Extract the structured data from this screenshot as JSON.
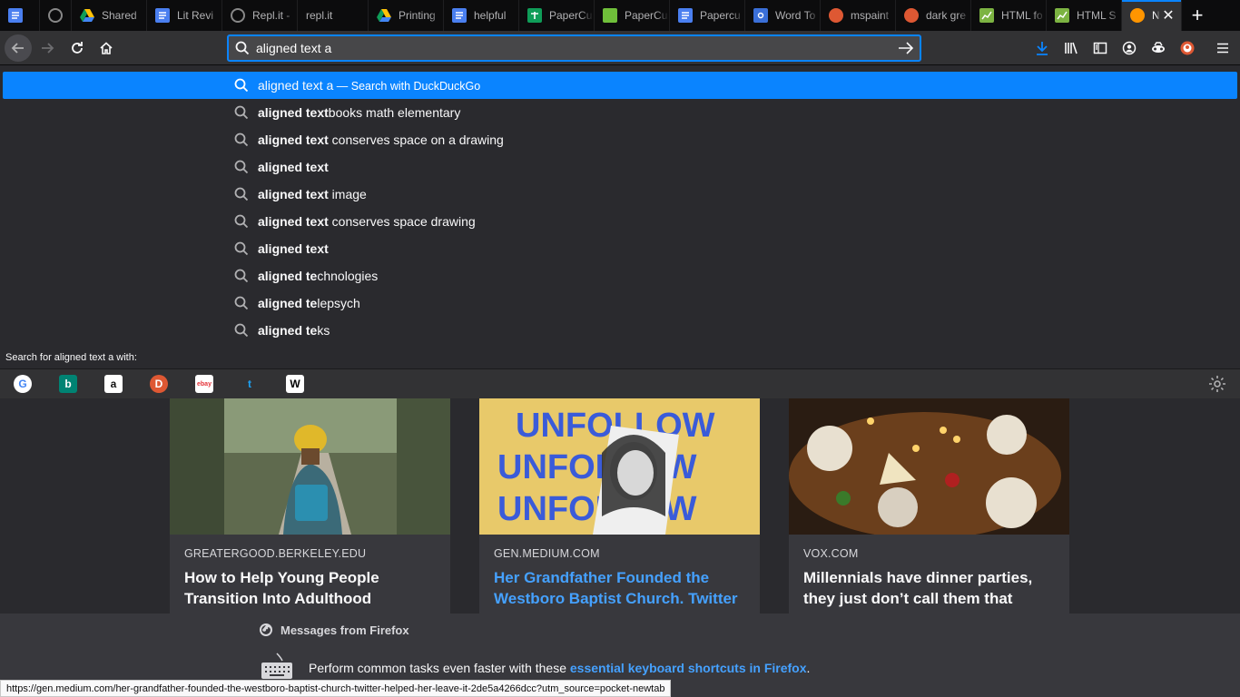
{
  "tabs": [
    {
      "label": "",
      "icon": "google-docs-icon",
      "color": "#4a7ff0"
    },
    {
      "label": "",
      "icon": "replit-icon",
      "color": "#888888"
    },
    {
      "label": "Shared",
      "icon": "google-drive-icon",
      "color": "#f4b400"
    },
    {
      "label": "Lit Revi",
      "icon": "google-docs-icon",
      "color": "#4a7ff0"
    },
    {
      "label": "Repl.it -",
      "icon": "replit-icon",
      "color": "#888888"
    },
    {
      "label": "repl.it",
      "icon": "",
      "color": ""
    },
    {
      "label": "Printing",
      "icon": "google-drive-icon",
      "color": "#f4b400"
    },
    {
      "label": "helpful",
      "icon": "google-docs-icon",
      "color": "#4a7ff0"
    },
    {
      "label": "PaperCu",
      "icon": "google-sheets-icon",
      "color": "#0f9d58"
    },
    {
      "label": "PaperCu",
      "icon": "papercut-icon",
      "color": "#6fbf3a"
    },
    {
      "label": "Papercu",
      "icon": "google-docs-icon",
      "color": "#4a7ff0"
    },
    {
      "label": "Word To",
      "icon": "gear-icon",
      "color": "#3a6fd8"
    },
    {
      "label": "mspaint",
      "icon": "duckduckgo-icon",
      "color": "#de5833"
    },
    {
      "label": "dark gre",
      "icon": "duckduckgo-icon",
      "color": "#de5833"
    },
    {
      "label": "HTML fo",
      "icon": "chart-icon",
      "color": "#7cb342"
    },
    {
      "label": "HTML S",
      "icon": "chart-icon",
      "color": "#7cb342"
    },
    {
      "label": "New",
      "icon": "firefox-icon",
      "color": "#ff9500",
      "active": true
    }
  ],
  "urlbar": {
    "value": "aligned text a"
  },
  "suggestions": [
    {
      "bold": "aligned text a",
      "rest": "",
      "action": "Search with DuckDuckGo",
      "sep": "—"
    },
    {
      "bold": "aligned text",
      "rest": "books math elementary"
    },
    {
      "bold": "aligned text",
      "rest": " conserves space on a drawing"
    },
    {
      "bold": "aligned text",
      "rest": ""
    },
    {
      "bold": "aligned text",
      "rest": " image"
    },
    {
      "bold": "aligned text",
      "rest": " conserves space drawing"
    },
    {
      "bold": "aligned text",
      "rest": ""
    },
    {
      "bold": "aligned te",
      "rest": "chnologies"
    },
    {
      "bold": "aligned te",
      "rest": "lepsych"
    },
    {
      "bold": "aligned te",
      "rest": "ks"
    }
  ],
  "oneoff": {
    "label": "Search for aligned text a with:",
    "engines": [
      {
        "name": "google",
        "glyph": "G",
        "bg": "#ffffff",
        "fg": "#4285f4"
      },
      {
        "name": "bing",
        "glyph": "b",
        "bg": "#008373",
        "fg": "#ffffff"
      },
      {
        "name": "amazon",
        "glyph": "a",
        "bg": "#ffffff",
        "fg": "#111111"
      },
      {
        "name": "duckduckgo",
        "glyph": "D",
        "bg": "#de5833",
        "fg": "#ffffff"
      },
      {
        "name": "ebay",
        "glyph": "ebay",
        "bg": "#ffffff",
        "fg": "#e53238"
      },
      {
        "name": "twitter",
        "glyph": "t",
        "bg": "transparent",
        "fg": "#1da1f2"
      },
      {
        "name": "wikipedia",
        "glyph": "W",
        "bg": "#ffffff",
        "fg": "#000000"
      }
    ]
  },
  "cards": [
    {
      "source": "GREATERGOOD.BERKELEY.EDU",
      "title": "How to Help Young People Transition Into Adulthood",
      "link": false
    },
    {
      "source": "GEN.MEDIUM.COM",
      "title": "Her Grandfather Founded the Westboro Baptist Church. Twitter Helped Her Leave It",
      "link": true,
      "image_text": "UNFOLLOW"
    },
    {
      "source": "VOX.COM",
      "title": "Millennials have dinner parties, they just don’t call them that",
      "link": false
    }
  ],
  "messages": {
    "heading": "Messages from Firefox",
    "text": "Perform common tasks even faster with these ",
    "link": "essential keyboard shortcuts in Firefox",
    "end": "."
  },
  "status_url": "https://gen.medium.com/her-grandfather-founded-the-westboro-baptist-church-twitter-helped-her-leave-it-2de5a4266dcc?utm_source=pocket-newtab"
}
